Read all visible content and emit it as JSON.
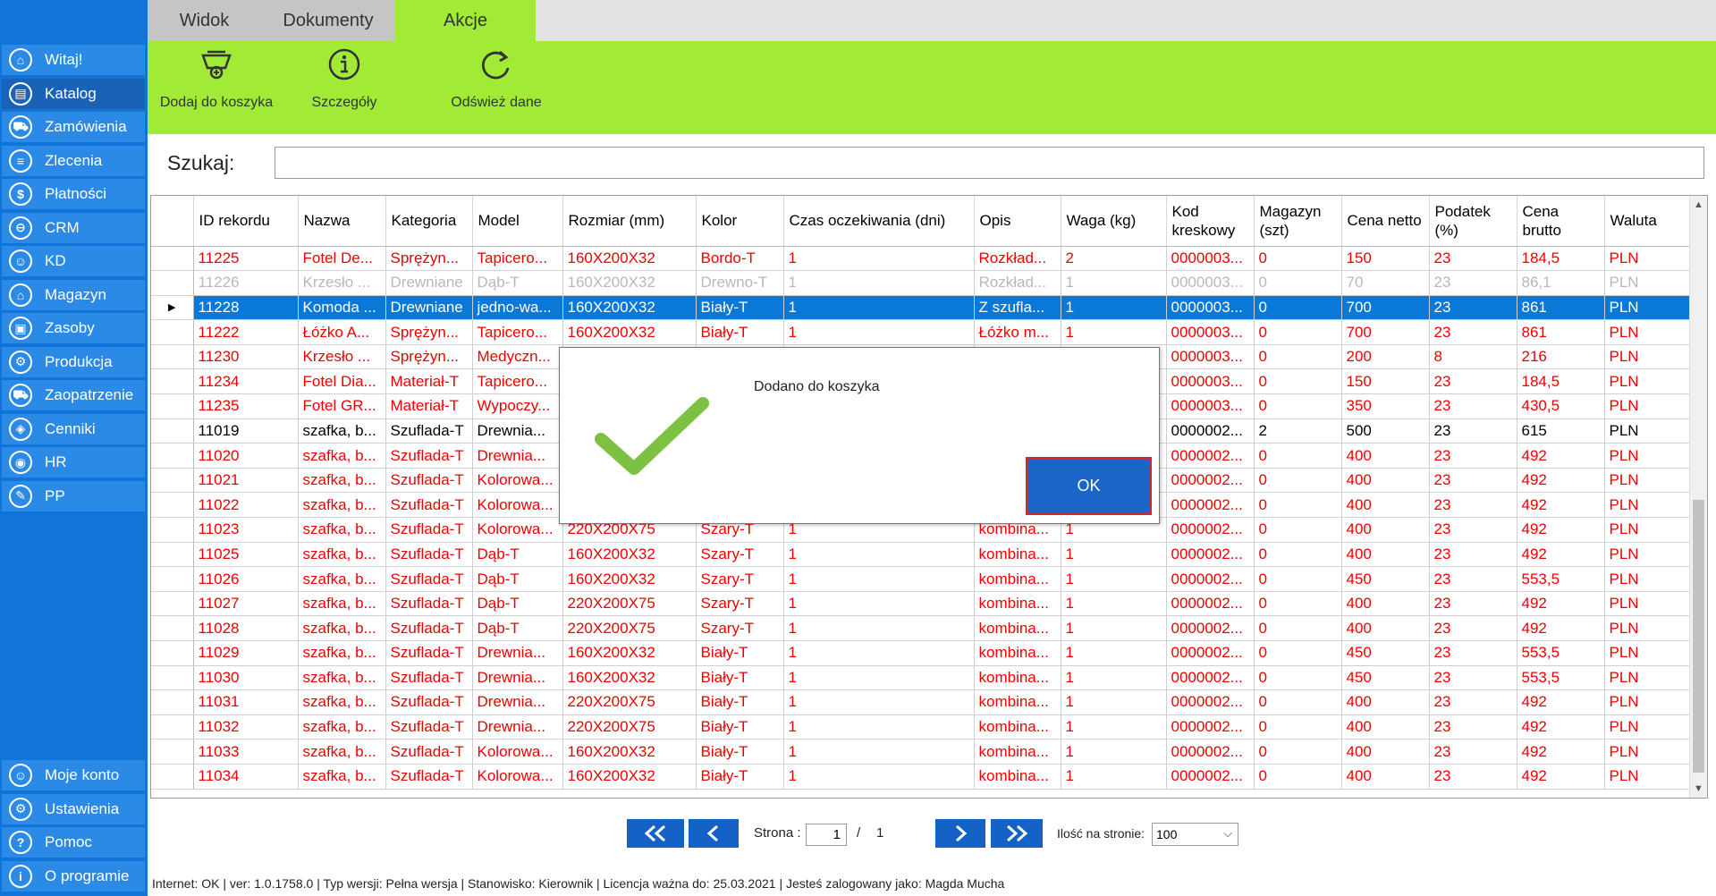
{
  "sidebar": {
    "items": [
      {
        "label": "Witaj!",
        "icon": "home-icon",
        "glyph": "⌂"
      },
      {
        "label": "Katalog",
        "icon": "book-icon",
        "glyph": "▤",
        "active": true
      },
      {
        "label": "Zamówienia",
        "icon": "cart-icon",
        "glyph": "⛟"
      },
      {
        "label": "Zlecenia",
        "icon": "list-icon",
        "glyph": "≡"
      },
      {
        "label": "Płatności",
        "icon": "dollar-icon",
        "glyph": "$"
      },
      {
        "label": "CRM",
        "icon": "crm-icon",
        "glyph": "⊖"
      },
      {
        "label": "KD",
        "icon": "person-icon",
        "glyph": "☺"
      },
      {
        "label": "Magazyn",
        "icon": "warehouse-icon",
        "glyph": "⌂"
      },
      {
        "label": "Zasoby",
        "icon": "resources-icon",
        "glyph": "▣"
      },
      {
        "label": "Produkcja",
        "icon": "production-icon",
        "glyph": "⚙"
      },
      {
        "label": "Zaopatrzenie",
        "icon": "supply-icon",
        "glyph": "⛟"
      },
      {
        "label": "Cenniki",
        "icon": "price-tag-icon",
        "glyph": "◈"
      },
      {
        "label": "HR",
        "icon": "hr-icon",
        "glyph": "◉"
      },
      {
        "label": "PP",
        "icon": "pp-icon",
        "glyph": "✎"
      }
    ],
    "bottom_items": [
      {
        "label": "Moje konto",
        "icon": "account-icon",
        "glyph": "☺"
      },
      {
        "label": "Ustawienia",
        "icon": "settings-icon",
        "glyph": "⚙"
      },
      {
        "label": "Pomoc",
        "icon": "help-icon",
        "glyph": "?"
      },
      {
        "label": "O programie",
        "icon": "info-icon",
        "glyph": "i"
      }
    ]
  },
  "tabs": [
    {
      "label": "Widok",
      "state": "inactive"
    },
    {
      "label": "Dokumenty",
      "state": "inactive"
    },
    {
      "label": "Akcje",
      "state": "active"
    }
  ],
  "ribbon": {
    "add_to_cart": "Dodaj do koszyka",
    "details": "Szczegóły",
    "refresh": "Odśwież dane"
  },
  "search": {
    "label": "Szukaj:",
    "value": ""
  },
  "table": {
    "columns": [
      "ID rekordu",
      "Nazwa",
      "Kategoria",
      "Model",
      "Rozmiar (mm)",
      "Kolor",
      "Czas oczekiwania (dni)",
      "Opis",
      "Waga (kg)",
      "Kod kreskowy",
      "Magazyn (szt)",
      "Cena netto",
      "Podatek (%)",
      "Cena brutto",
      "Waluta"
    ],
    "rows": [
      {
        "style": "red",
        "cells": [
          "11225",
          "Fotel De...",
          "Sprężyn...",
          "Tapicero...",
          "160X200X32",
          "Bordo-T",
          "1",
          "Rozkład...",
          "2",
          "0000003...",
          "0",
          "150",
          "23",
          "184,5",
          "PLN"
        ]
      },
      {
        "style": "gray",
        "cells": [
          "11226",
          "Krzesło ...",
          "Drewniane",
          "Dąb-T",
          "160X200X32",
          "Drewno-T",
          "1",
          "Rozkład...",
          "1",
          "0000003...",
          "0",
          "70",
          "23",
          "86,1",
          "PLN"
        ]
      },
      {
        "style": "sel",
        "cells": [
          "11228",
          "Komoda ...",
          "Drewniane",
          "jedno-wa...",
          "160X200X32",
          "Biały-T",
          "1",
          "Z szufla...",
          "1",
          "0000003...",
          "0",
          "700",
          "23",
          "861",
          "PLN"
        ]
      },
      {
        "style": "red",
        "cells": [
          "11222",
          "Łóżko A...",
          "Sprężyn...",
          "Tapicero...",
          "160X200X32",
          "Biały-T",
          "1",
          "Łóżko m...",
          "1",
          "0000003...",
          "0",
          "700",
          "23",
          "861",
          "PLN"
        ]
      },
      {
        "style": "red",
        "cells": [
          "11230",
          "Krzesło ...",
          "Sprężyn...",
          "Medyczn...",
          "",
          "",
          "",
          "",
          "",
          "0000003...",
          "0",
          "200",
          "8",
          "216",
          "PLN"
        ]
      },
      {
        "style": "red",
        "cells": [
          "11234",
          "Fotel Dia...",
          "Materiał-T",
          "Tapicero...",
          "",
          "",
          "",
          "",
          "",
          "0000003...",
          "0",
          "150",
          "23",
          "184,5",
          "PLN"
        ]
      },
      {
        "style": "red",
        "cells": [
          "11235",
          "Fotel GR...",
          "Materiał-T",
          "Wypoczy...",
          "",
          "",
          "",
          "",
          "",
          "0000003...",
          "0",
          "350",
          "23",
          "430,5",
          "PLN"
        ]
      },
      {
        "style": "black",
        "cells": [
          "11019",
          "szafka, b...",
          "Szuflada-T",
          "Drewnia...",
          "",
          "",
          "",
          "",
          "",
          "0000002...",
          "2",
          "500",
          "23",
          "615",
          "PLN"
        ]
      },
      {
        "style": "red",
        "cells": [
          "11020",
          "szafka, b...",
          "Szuflada-T",
          "Drewnia...",
          "",
          "",
          "",
          "",
          "",
          "0000002...",
          "0",
          "400",
          "23",
          "492",
          "PLN"
        ]
      },
      {
        "style": "red",
        "cells": [
          "11021",
          "szafka, b...",
          "Szuflada-T",
          "Kolorowa...",
          "",
          "",
          "",
          "",
          "",
          "0000002...",
          "0",
          "400",
          "23",
          "492",
          "PLN"
        ]
      },
      {
        "style": "red",
        "cells": [
          "11022",
          "szafka, b...",
          "Szuflada-T",
          "Kolorowa...",
          "",
          "",
          "",
          "",
          "",
          "0000002...",
          "0",
          "400",
          "23",
          "492",
          "PLN"
        ]
      },
      {
        "style": "red",
        "cells": [
          "11023",
          "szafka, b...",
          "Szuflada-T",
          "Kolorowa...",
          "220X200X75",
          "Szary-T",
          "1",
          "kombina...",
          "1",
          "0000002...",
          "0",
          "400",
          "23",
          "492",
          "PLN"
        ]
      },
      {
        "style": "red",
        "cells": [
          "11025",
          "szafka, b...",
          "Szuflada-T",
          "Dąb-T",
          "160X200X32",
          "Szary-T",
          "1",
          "kombina...",
          "1",
          "0000002...",
          "0",
          "400",
          "23",
          "492",
          "PLN"
        ]
      },
      {
        "style": "red",
        "cells": [
          "11026",
          "szafka, b...",
          "Szuflada-T",
          "Dąb-T",
          "160X200X32",
          "Szary-T",
          "1",
          "kombina...",
          "1",
          "0000002...",
          "0",
          "450",
          "23",
          "553,5",
          "PLN"
        ]
      },
      {
        "style": "red",
        "cells": [
          "11027",
          "szafka, b...",
          "Szuflada-T",
          "Dąb-T",
          "220X200X75",
          "Szary-T",
          "1",
          "kombina...",
          "1",
          "0000002...",
          "0",
          "400",
          "23",
          "492",
          "PLN"
        ]
      },
      {
        "style": "red",
        "cells": [
          "11028",
          "szafka, b...",
          "Szuflada-T",
          "Dąb-T",
          "220X200X75",
          "Szary-T",
          "1",
          "kombina...",
          "1",
          "0000002...",
          "0",
          "400",
          "23",
          "492",
          "PLN"
        ]
      },
      {
        "style": "red",
        "cells": [
          "11029",
          "szafka, b...",
          "Szuflada-T",
          "Drewnia...",
          "160X200X32",
          "Biały-T",
          "1",
          "kombina...",
          "1",
          "0000002...",
          "0",
          "450",
          "23",
          "553,5",
          "PLN"
        ]
      },
      {
        "style": "red",
        "cells": [
          "11030",
          "szafka, b...",
          "Szuflada-T",
          "Drewnia...",
          "160X200X32",
          "Biały-T",
          "1",
          "kombina...",
          "1",
          "0000002...",
          "0",
          "450",
          "23",
          "553,5",
          "PLN"
        ]
      },
      {
        "style": "red",
        "cells": [
          "11031",
          "szafka, b...",
          "Szuflada-T",
          "Drewnia...",
          "220X200X75",
          "Biały-T",
          "1",
          "kombina...",
          "1",
          "0000002...",
          "0",
          "400",
          "23",
          "492",
          "PLN"
        ]
      },
      {
        "style": "red",
        "cells": [
          "11032",
          "szafka, b...",
          "Szuflada-T",
          "Drewnia...",
          "220X200X75",
          "Biały-T",
          "1",
          "kombina...",
          "1",
          "0000002...",
          "0",
          "400",
          "23",
          "492",
          "PLN"
        ]
      },
      {
        "style": "red",
        "cells": [
          "11033",
          "szafka, b...",
          "Szuflada-T",
          "Kolorowa...",
          "160X200X32",
          "Biały-T",
          "1",
          "kombina...",
          "1",
          "0000002...",
          "0",
          "400",
          "23",
          "492",
          "PLN"
        ]
      },
      {
        "style": "red",
        "cells": [
          "11034",
          "szafka, b...",
          "Szuflada-T",
          "Kolorowa...",
          "160X200X32",
          "Biały-T",
          "1",
          "kombina...",
          "1",
          "0000002...",
          "0",
          "400",
          "23",
          "492",
          "PLN"
        ]
      }
    ]
  },
  "dialog": {
    "message": "Dodano do koszyka",
    "ok_label": "OK"
  },
  "pager": {
    "page_label": "Strona :",
    "current_page": "1",
    "separator": "/",
    "total_pages": "1",
    "per_page_label": "Ilość na stronie:",
    "per_page_value": "100"
  },
  "statusbar": {
    "text": "Internet: OK  |  ver: 1.0.1758.0  |  Typ wersji: Pełna wersja  |  Stanowisko: Kierownik  |  Licencja ważna do: 25.03.2021  |  Jesteś zalogowany jako: Magda Mucha"
  },
  "colors": {
    "accent_green": "#a1ea35",
    "sidebar_blue": "#1174d8",
    "selection_blue": "#0a78d7",
    "row_red": "#ee0000"
  }
}
